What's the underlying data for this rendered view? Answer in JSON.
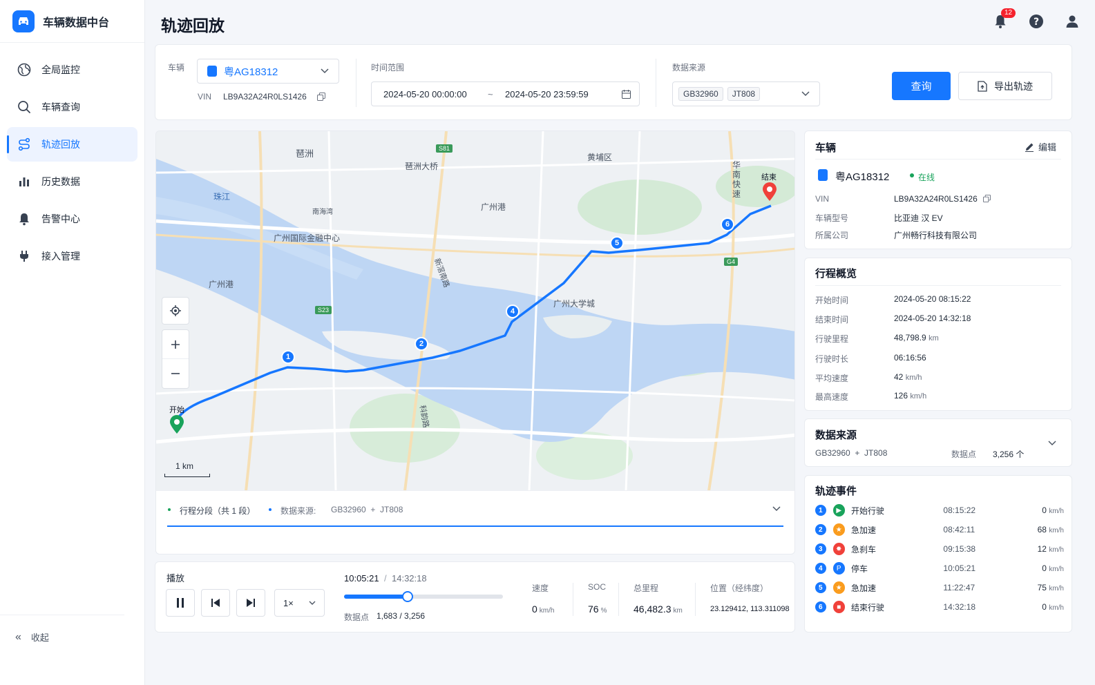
{
  "app": {
    "title": "车辆数据中台"
  },
  "sidebar": {
    "items": [
      {
        "label": "全局监控",
        "icon": "globe-icon"
      },
      {
        "label": "车辆查询",
        "icon": "search-icon"
      },
      {
        "label": "轨迹回放",
        "icon": "route-icon",
        "active": true
      },
      {
        "label": "历史数据",
        "icon": "bar-chart-icon"
      },
      {
        "label": "告警中心",
        "icon": "bell-icon"
      },
      {
        "label": "接入管理",
        "icon": "plug-icon"
      }
    ],
    "collapse_label": "收起"
  },
  "header": {
    "title": "轨迹回放",
    "notification_count": "12"
  },
  "filter": {
    "vehicle_label": "车辆",
    "vehicle_value": "粤AG18312",
    "vin_label": "VIN",
    "vin_value": "LB9A32A24R0LS1426",
    "time_label": "时间范围",
    "time_start": "2024-05-20 00:00:00",
    "time_sep": "~",
    "time_end": "2024-05-20 23:59:59",
    "source_label": "数据来源",
    "source_tags": [
      "GB32960",
      "JT808"
    ],
    "query_button": "查询",
    "export_button": "导出轨迹"
  },
  "map": {
    "labels": {
      "pizhou": "琶洲",
      "pizhou_bridge": "琶洲大桥",
      "huangpu": "黄埔区",
      "zhujiang": "珠江",
      "nanhaiwan": "南海湾",
      "guangzhou_port_1": "广州港",
      "ifc": "广州国际金融中心",
      "guangzhou_port_2": "广州港",
      "university_city": "广州大学城",
      "huanan_expressway": "华南快速",
      "xinjiao_rd": "新滘南路",
      "kekang_rd": "科韵路"
    },
    "road_badges": [
      "S81",
      "S23",
      "G4"
    ],
    "start_label": "开始",
    "end_label": "结束",
    "scale_label": "1 km",
    "markers": [
      "1",
      "2",
      "4",
      "5",
      "6"
    ]
  },
  "segments": {
    "segment_label": "行程分段（共 1 段）",
    "source_label": "数据来源:",
    "source_value": "GB32960  +  JT808"
  },
  "player": {
    "title": "播放",
    "current_time": "10:05:21",
    "sep": "/",
    "end_time": "14:32:18",
    "speed_option": "1×",
    "progress": 0.4,
    "points_label": "数据点",
    "points_value": "1,683 / 3,256",
    "stats": {
      "speed_label": "速度",
      "speed_value": "0",
      "speed_unit": "km/h",
      "soc_label": "SOC",
      "soc_value": "76",
      "soc_unit": "%",
      "mileage_label": "总里程",
      "mileage_value": "46,482.3",
      "mileage_unit": "km",
      "position_label": "位置（经纬度）",
      "position_value": "23.129412, 113.311098"
    }
  },
  "vehicle_card": {
    "title": "车辆",
    "edit_label": "编辑",
    "plate": "粤AG18312",
    "status": "在线",
    "rows": [
      {
        "k": "VIN",
        "v": "LB9A32A24R0LS1426"
      },
      {
        "k": "车辆型号",
        "v": "比亚迪 汉 EV"
      },
      {
        "k": "所属公司",
        "v": "广州畅行科技有限公司"
      }
    ]
  },
  "trip_card": {
    "title": "行程概览",
    "rows": [
      {
        "k": "开始时间",
        "v": "2024-05-20 08:15:22",
        "u": ""
      },
      {
        "k": "结束时间",
        "v": "2024-05-20 14:32:18",
        "u": ""
      },
      {
        "k": "行驶里程",
        "v": "48,798.9",
        "u": "km"
      },
      {
        "k": "行驶时长",
        "v": "06:16:56",
        "u": ""
      },
      {
        "k": "平均速度",
        "v": "42",
        "u": "km/h"
      },
      {
        "k": "最高速度",
        "v": "126",
        "u": "km/h"
      }
    ]
  },
  "source_card": {
    "title": "数据来源",
    "value": "GB32960  +  JT808",
    "points_label": "数据点",
    "points_value": "3,256 个"
  },
  "events_card": {
    "title": "轨迹事件",
    "events": [
      {
        "n": "1",
        "name": "开始行驶",
        "time": "08:15:22",
        "speed": "0",
        "unit": "km/h",
        "color": "#19a35b"
      },
      {
        "n": "2",
        "name": "急加速",
        "time": "08:42:11",
        "speed": "68",
        "unit": "km/h",
        "color": "#fa9c1e"
      },
      {
        "n": "3",
        "name": "急刹车",
        "time": "09:15:38",
        "speed": "12",
        "unit": "km/h",
        "color": "#f0413a"
      },
      {
        "n": "4",
        "name": "停车",
        "time": "10:05:21",
        "speed": "0",
        "unit": "km/h",
        "color": "#1677ff"
      },
      {
        "n": "5",
        "name": "急加速",
        "time": "11:22:47",
        "speed": "75",
        "unit": "km/h",
        "color": "#fa9c1e"
      },
      {
        "n": "6",
        "name": "结束行驶",
        "time": "14:32:18",
        "speed": "0",
        "unit": "km/h",
        "color": "#f0413a"
      }
    ]
  }
}
